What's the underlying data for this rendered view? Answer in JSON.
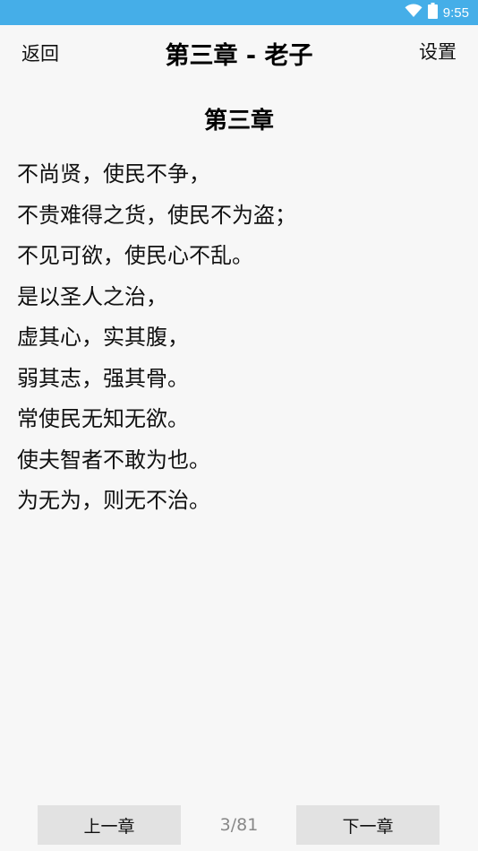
{
  "status_bar": {
    "time": "9:55",
    "icons": [
      "wifi-icon",
      "battery-icon"
    ],
    "color": "#45aee8"
  },
  "header": {
    "back_label": "返回",
    "title": "第三章 - 老子",
    "settings_label": "设置"
  },
  "chapter": {
    "heading": "第三章",
    "lines": [
      "不尚贤，使民不争，",
      "不贵难得之货，使民不为盗；",
      "不见可欲，使民心不乱。",
      "是以圣人之治，",
      "虚其心，实其腹，",
      "弱其志，强其骨。",
      "常使民无知无欲。",
      "使夫智者不敢为也。",
      "为无为，则无不治。"
    ]
  },
  "footer": {
    "prev_label": "上一章",
    "page_indicator": "3/81",
    "next_label": "下一章"
  }
}
